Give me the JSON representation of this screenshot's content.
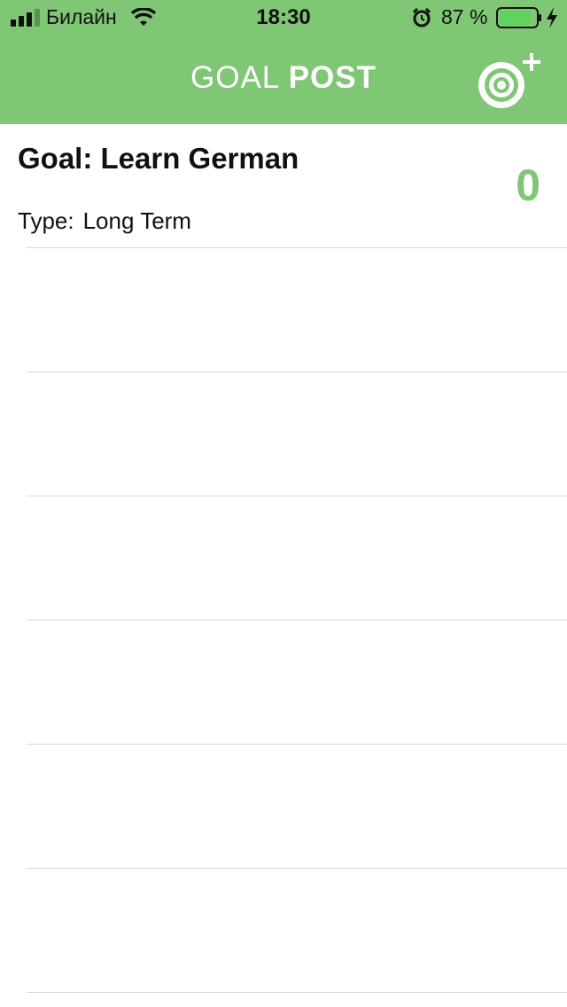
{
  "status_bar": {
    "carrier": "Билайн",
    "time": "18:30",
    "battery_percent": "87 %",
    "battery_level": 0.87
  },
  "header": {
    "title_light": "GOAL",
    "title_bold": "POST",
    "add_goal_icon": "target-plus-icon"
  },
  "goal": {
    "title": "Goal: Learn German",
    "type_label": "Type:",
    "type_value": "Long Term",
    "count": "0"
  },
  "colors": {
    "accent": "#7fc675",
    "divider": "#d6d6d6"
  }
}
